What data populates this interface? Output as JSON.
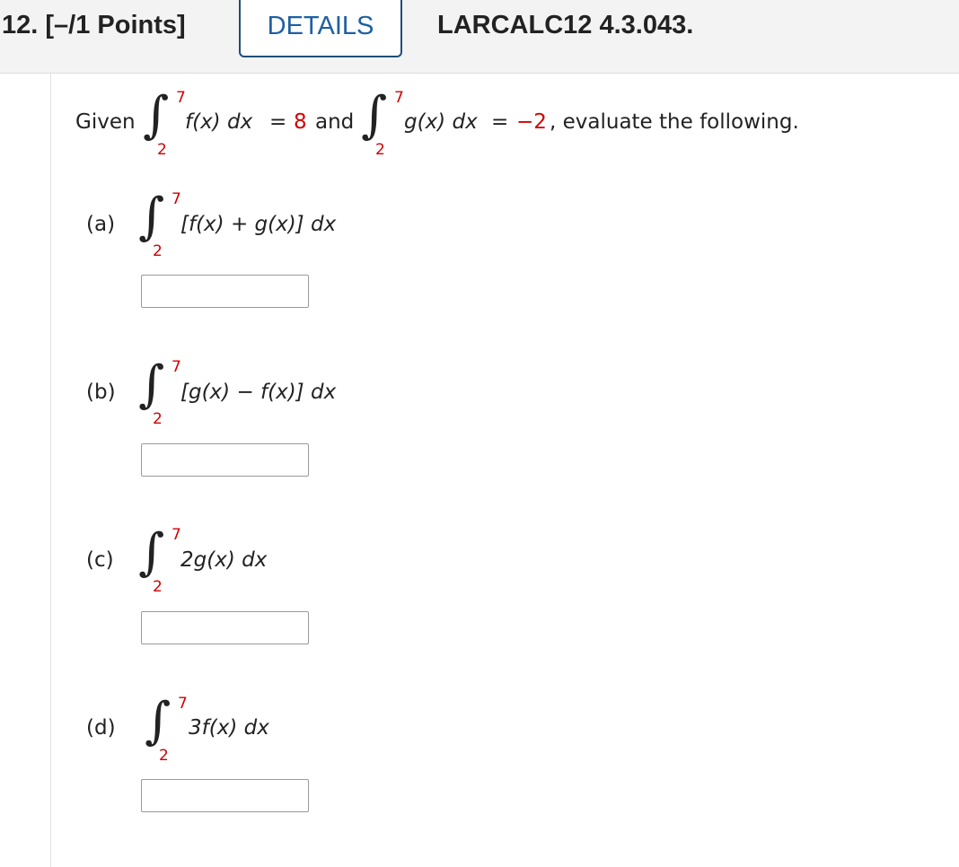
{
  "header": {
    "title": "12. [–/1 Points]",
    "details_label": "DETAILS",
    "problem_code": "LARCALC12 4.3.043."
  },
  "given": {
    "word_given": "Given",
    "integral1_upper": "7",
    "integral1_lower": "2",
    "integral1_integrand": "f(x) dx",
    "equals1": "=",
    "value1": "8",
    "word_and": "and",
    "integral2_upper": "7",
    "integral2_lower": "2",
    "integral2_integrand": "g(x) dx",
    "equals2": "=",
    "value2": "−2",
    "tail": ", evaluate the following."
  },
  "parts": [
    {
      "label": "(a)",
      "upper": "7",
      "lower": "2",
      "integrand": "[f(x) + g(x)] dx",
      "answer": ""
    },
    {
      "label": "(b)",
      "upper": "7",
      "lower": "2",
      "integrand": "[g(x) − f(x)] dx",
      "answer": ""
    },
    {
      "label": "(c)",
      "upper": "7",
      "lower": "2",
      "integrand": "2g(x) dx",
      "answer": ""
    },
    {
      "label": "(d)",
      "upper": "7",
      "lower": "2",
      "integrand": "3f(x) dx",
      "answer": ""
    }
  ],
  "colors": {
    "accent": "#1f5fa3",
    "limits": "#d10000",
    "header_bg": "#f3f3f3"
  }
}
